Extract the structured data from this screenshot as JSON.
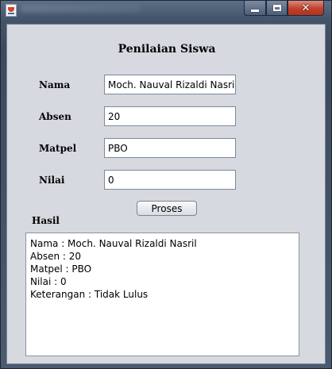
{
  "form": {
    "heading": "Penilaian Siswa",
    "fields": [
      {
        "label": "Nama",
        "value": "Moch. Nauval Rizaldi Nasril"
      },
      {
        "label": "Absen",
        "value": "20"
      },
      {
        "label": "Matpel",
        "value": "PBO"
      },
      {
        "label": "Nilai",
        "value": "0"
      }
    ],
    "submit_label": "Proses",
    "result_label": "Hasil",
    "result_lines": [
      "Nama : Moch. Nauval Rizaldi Nasril",
      "Absen : 20",
      "Matpel : PBO",
      "Nilai : 0",
      "Keterangan : Tidak Lulus"
    ]
  },
  "window_controls": {
    "minimize_icon": "minimize-icon",
    "maximize_icon": "maximize-icon",
    "close_icon": "close-icon",
    "close_color": "#c2402b"
  }
}
